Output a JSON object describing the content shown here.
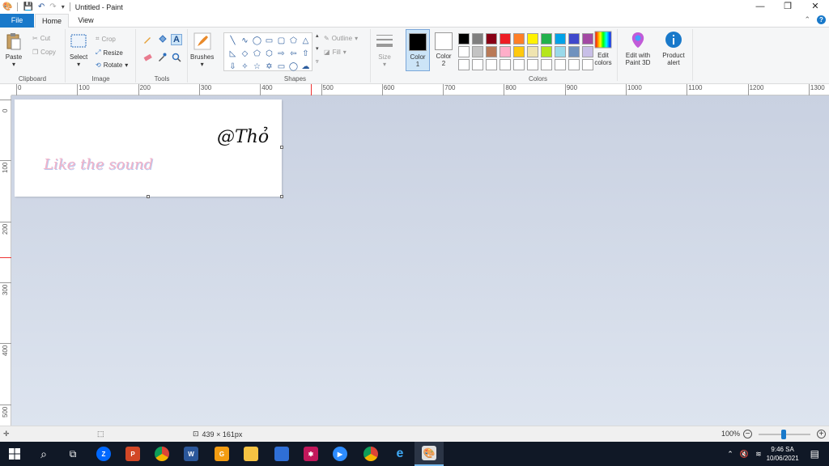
{
  "window": {
    "title": "Untitled - Paint",
    "controls": [
      "—",
      "❐",
      "✕"
    ]
  },
  "tabs": {
    "file": "File",
    "home": "Home",
    "view": "View"
  },
  "ribbon": {
    "clipboard": {
      "label": "Clipboard",
      "paste": "Paste",
      "cut": "Cut",
      "copy": "Copy"
    },
    "image": {
      "label": "Image",
      "select": "Select",
      "crop": "Crop",
      "resize": "Resize",
      "rotate": "Rotate"
    },
    "tools": {
      "label": "Tools"
    },
    "brushes": {
      "label": "Brushes"
    },
    "shapes": {
      "label": "Shapes",
      "outline": "Outline",
      "fill": "Fill"
    },
    "size": {
      "label": "Size"
    },
    "color1": {
      "label": "Color",
      "num": "1",
      "value": "#000000"
    },
    "color2": {
      "label": "Color",
      "num": "2",
      "value": "#ffffff"
    },
    "colors": {
      "label": "Colors",
      "edit_colors_1": "Edit",
      "edit_colors_2": "colors",
      "palette": [
        "#000000",
        "#7f7f7f",
        "#880015",
        "#ed1c24",
        "#ff7f27",
        "#fff200",
        "#22b14c",
        "#00a2e8",
        "#3f48cc",
        "#a349a4",
        "#ffffff",
        "#c3c3c3",
        "#b97a57",
        "#ffaec9",
        "#ffc90e",
        "#efe4b0",
        "#b5e61d",
        "#99d9ea",
        "#7092be",
        "#c8bfe7",
        "#ffffff",
        "#ffffff",
        "#ffffff",
        "#ffffff",
        "#ffffff",
        "#ffffff",
        "#ffffff",
        "#ffffff",
        "#ffffff",
        "#ffffff"
      ]
    },
    "paint3d": {
      "line1": "Edit with",
      "line2": "Paint 3D"
    },
    "product_alert": {
      "line1": "Product",
      "line2": "alert"
    }
  },
  "ruler": {
    "top": [
      "0",
      "100",
      "200",
      "300",
      "400",
      "500",
      "600",
      "700",
      "800",
      "900",
      "1000",
      "1100",
      "1200",
      "1300"
    ],
    "left": [
      "0",
      "100",
      "200",
      "300",
      "400",
      "500"
    ]
  },
  "canvas": {
    "text_signature": "@Thỏ",
    "text_caption": "Like the sound"
  },
  "status": {
    "dimensions": "439 × 161px",
    "zoom": "100%"
  },
  "taskbar": {
    "time": "9:46 SA",
    "date": "10/06/2021"
  }
}
